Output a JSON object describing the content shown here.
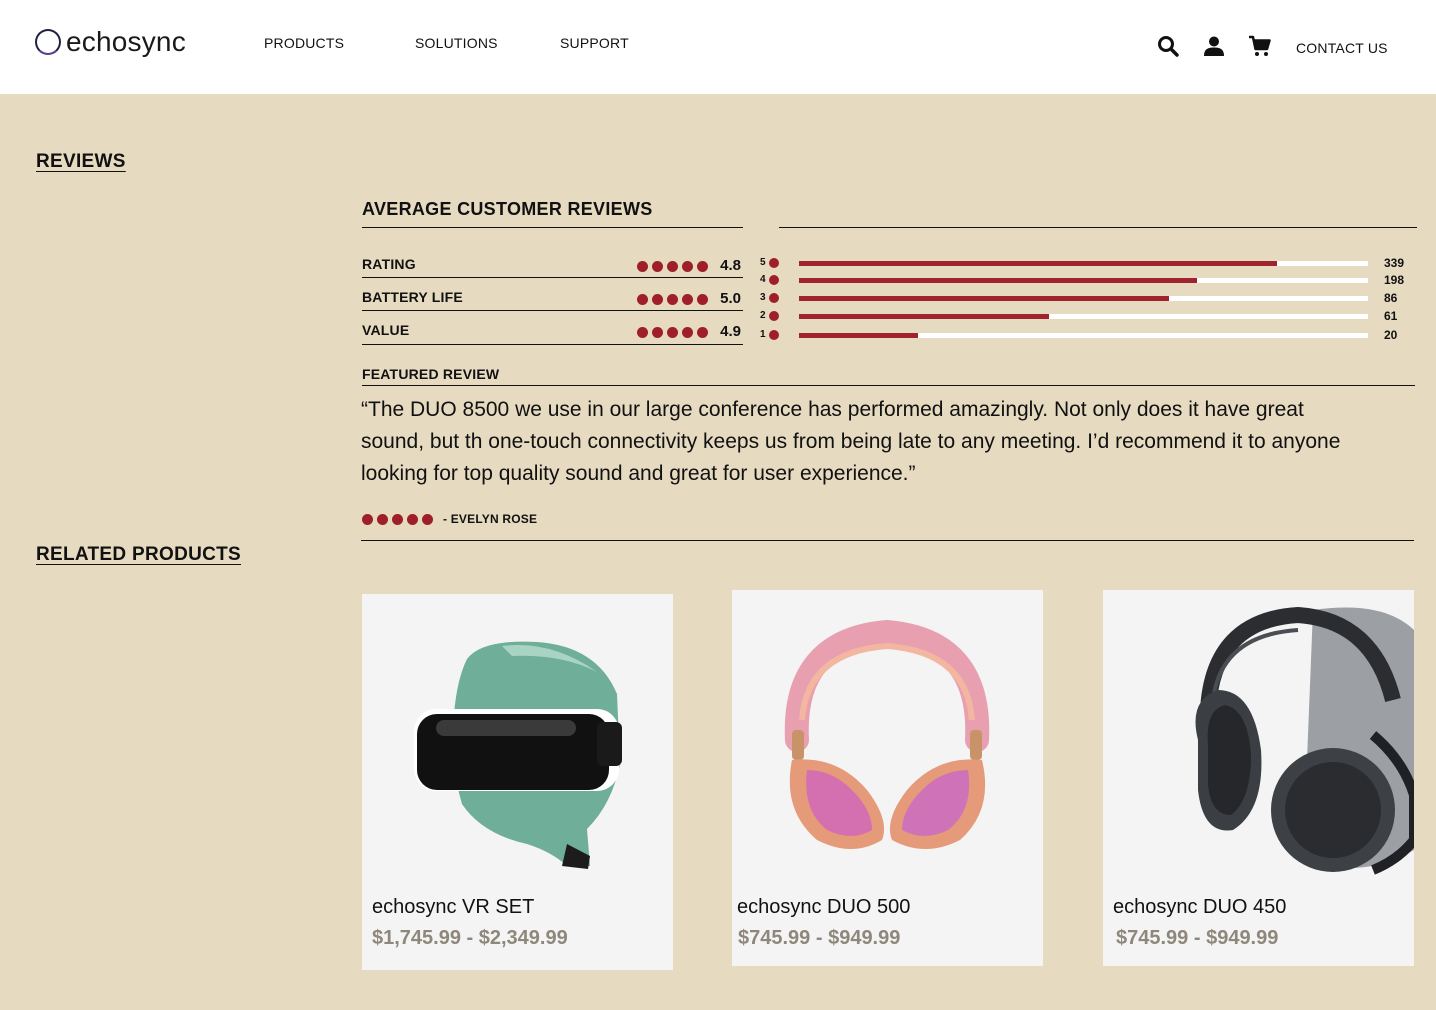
{
  "header": {
    "logo_text": "echosync",
    "nav": [
      "PRODUCTS",
      "SOLUTIONS",
      "SUPPORT"
    ],
    "contact": "CONTACT US",
    "icons": [
      "search-icon",
      "user-icon",
      "cart-icon"
    ]
  },
  "reviews": {
    "section_title": "REVIEWS",
    "avg_title": "AVERAGE CUSTOMER REVIEWS",
    "criteria": [
      {
        "label": "RATING",
        "value": "4.8",
        "dots": 5
      },
      {
        "label": "BATTERY LIFE",
        "value": "5.0",
        "dots": 5
      },
      {
        "label": "VALUE",
        "value": "4.9",
        "dots": 5
      }
    ],
    "distribution": [
      {
        "stars": "5",
        "count": "339",
        "fill": 0.84
      },
      {
        "stars": "4",
        "count": "198",
        "fill": 0.7
      },
      {
        "stars": "3",
        "count": "86",
        "fill": 0.65
      },
      {
        "stars": "2",
        "count": "61",
        "fill": 0.44
      },
      {
        "stars": "1",
        "count": "20",
        "fill": 0.21
      }
    ],
    "featured_label": "FEATURED REVIEW",
    "featured_quote": "“The DUO 8500 we use in our large conference has performed amazingly. Not only does it have great sound, but th one-touch connectivity keeps us from being late to any meeting. I’d recommend it to anyone looking for top quality sound and great for user experience.”",
    "featured_author": "- EVELYN ROSE",
    "featured_dots": 5
  },
  "related": {
    "section_title": "RELATED PRODUCTS",
    "products": [
      {
        "name": "echosync VR SET",
        "price": "$1,745.99 - $2,349.99",
        "image": "vr-headset"
      },
      {
        "name": "echosync DUO 500",
        "price": "$745.99 - $949.99",
        "image": "pink-headphones"
      },
      {
        "name": "echosync DUO 450",
        "price": "$745.99 - $949.99",
        "image": "black-headphones"
      }
    ]
  },
  "colors": {
    "accent": "#9e1f2a",
    "background": "#e6dac0",
    "card": "#f4f4f4",
    "price": "#8e877b"
  }
}
